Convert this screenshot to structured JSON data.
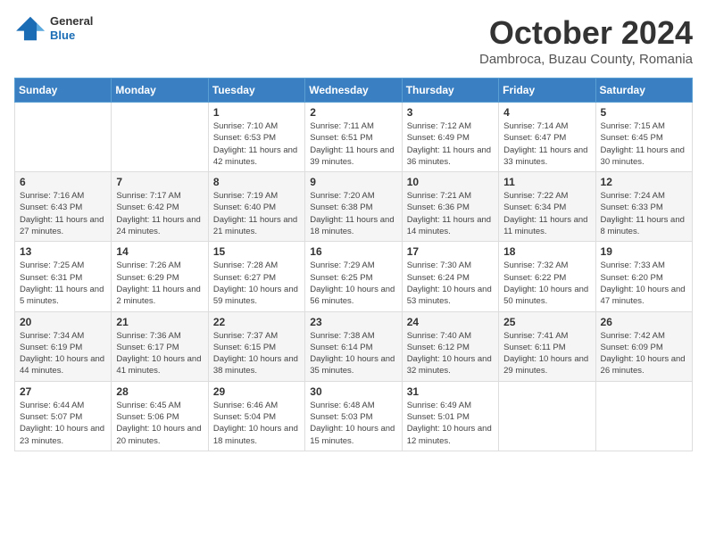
{
  "logo": {
    "general": "General",
    "blue": "Blue"
  },
  "header": {
    "month": "October 2024",
    "location": "Dambroca, Buzau County, Romania"
  },
  "weekdays": [
    "Sunday",
    "Monday",
    "Tuesday",
    "Wednesday",
    "Thursday",
    "Friday",
    "Saturday"
  ],
  "weeks": [
    [
      {
        "day": "",
        "info": ""
      },
      {
        "day": "",
        "info": ""
      },
      {
        "day": "1",
        "info": "Sunrise: 7:10 AM\nSunset: 6:53 PM\nDaylight: 11 hours and 42 minutes."
      },
      {
        "day": "2",
        "info": "Sunrise: 7:11 AM\nSunset: 6:51 PM\nDaylight: 11 hours and 39 minutes."
      },
      {
        "day": "3",
        "info": "Sunrise: 7:12 AM\nSunset: 6:49 PM\nDaylight: 11 hours and 36 minutes."
      },
      {
        "day": "4",
        "info": "Sunrise: 7:14 AM\nSunset: 6:47 PM\nDaylight: 11 hours and 33 minutes."
      },
      {
        "day": "5",
        "info": "Sunrise: 7:15 AM\nSunset: 6:45 PM\nDaylight: 11 hours and 30 minutes."
      }
    ],
    [
      {
        "day": "6",
        "info": "Sunrise: 7:16 AM\nSunset: 6:43 PM\nDaylight: 11 hours and 27 minutes."
      },
      {
        "day": "7",
        "info": "Sunrise: 7:17 AM\nSunset: 6:42 PM\nDaylight: 11 hours and 24 minutes."
      },
      {
        "day": "8",
        "info": "Sunrise: 7:19 AM\nSunset: 6:40 PM\nDaylight: 11 hours and 21 minutes."
      },
      {
        "day": "9",
        "info": "Sunrise: 7:20 AM\nSunset: 6:38 PM\nDaylight: 11 hours and 18 minutes."
      },
      {
        "day": "10",
        "info": "Sunrise: 7:21 AM\nSunset: 6:36 PM\nDaylight: 11 hours and 14 minutes."
      },
      {
        "day": "11",
        "info": "Sunrise: 7:22 AM\nSunset: 6:34 PM\nDaylight: 11 hours and 11 minutes."
      },
      {
        "day": "12",
        "info": "Sunrise: 7:24 AM\nSunset: 6:33 PM\nDaylight: 11 hours and 8 minutes."
      }
    ],
    [
      {
        "day": "13",
        "info": "Sunrise: 7:25 AM\nSunset: 6:31 PM\nDaylight: 11 hours and 5 minutes."
      },
      {
        "day": "14",
        "info": "Sunrise: 7:26 AM\nSunset: 6:29 PM\nDaylight: 11 hours and 2 minutes."
      },
      {
        "day": "15",
        "info": "Sunrise: 7:28 AM\nSunset: 6:27 PM\nDaylight: 10 hours and 59 minutes."
      },
      {
        "day": "16",
        "info": "Sunrise: 7:29 AM\nSunset: 6:25 PM\nDaylight: 10 hours and 56 minutes."
      },
      {
        "day": "17",
        "info": "Sunrise: 7:30 AM\nSunset: 6:24 PM\nDaylight: 10 hours and 53 minutes."
      },
      {
        "day": "18",
        "info": "Sunrise: 7:32 AM\nSunset: 6:22 PM\nDaylight: 10 hours and 50 minutes."
      },
      {
        "day": "19",
        "info": "Sunrise: 7:33 AM\nSunset: 6:20 PM\nDaylight: 10 hours and 47 minutes."
      }
    ],
    [
      {
        "day": "20",
        "info": "Sunrise: 7:34 AM\nSunset: 6:19 PM\nDaylight: 10 hours and 44 minutes."
      },
      {
        "day": "21",
        "info": "Sunrise: 7:36 AM\nSunset: 6:17 PM\nDaylight: 10 hours and 41 minutes."
      },
      {
        "day": "22",
        "info": "Sunrise: 7:37 AM\nSunset: 6:15 PM\nDaylight: 10 hours and 38 minutes."
      },
      {
        "day": "23",
        "info": "Sunrise: 7:38 AM\nSunset: 6:14 PM\nDaylight: 10 hours and 35 minutes."
      },
      {
        "day": "24",
        "info": "Sunrise: 7:40 AM\nSunset: 6:12 PM\nDaylight: 10 hours and 32 minutes."
      },
      {
        "day": "25",
        "info": "Sunrise: 7:41 AM\nSunset: 6:11 PM\nDaylight: 10 hours and 29 minutes."
      },
      {
        "day": "26",
        "info": "Sunrise: 7:42 AM\nSunset: 6:09 PM\nDaylight: 10 hours and 26 minutes."
      }
    ],
    [
      {
        "day": "27",
        "info": "Sunrise: 6:44 AM\nSunset: 5:07 PM\nDaylight: 10 hours and 23 minutes."
      },
      {
        "day": "28",
        "info": "Sunrise: 6:45 AM\nSunset: 5:06 PM\nDaylight: 10 hours and 20 minutes."
      },
      {
        "day": "29",
        "info": "Sunrise: 6:46 AM\nSunset: 5:04 PM\nDaylight: 10 hours and 18 minutes."
      },
      {
        "day": "30",
        "info": "Sunrise: 6:48 AM\nSunset: 5:03 PM\nDaylight: 10 hours and 15 minutes."
      },
      {
        "day": "31",
        "info": "Sunrise: 6:49 AM\nSunset: 5:01 PM\nDaylight: 10 hours and 12 minutes."
      },
      {
        "day": "",
        "info": ""
      },
      {
        "day": "",
        "info": ""
      }
    ]
  ]
}
